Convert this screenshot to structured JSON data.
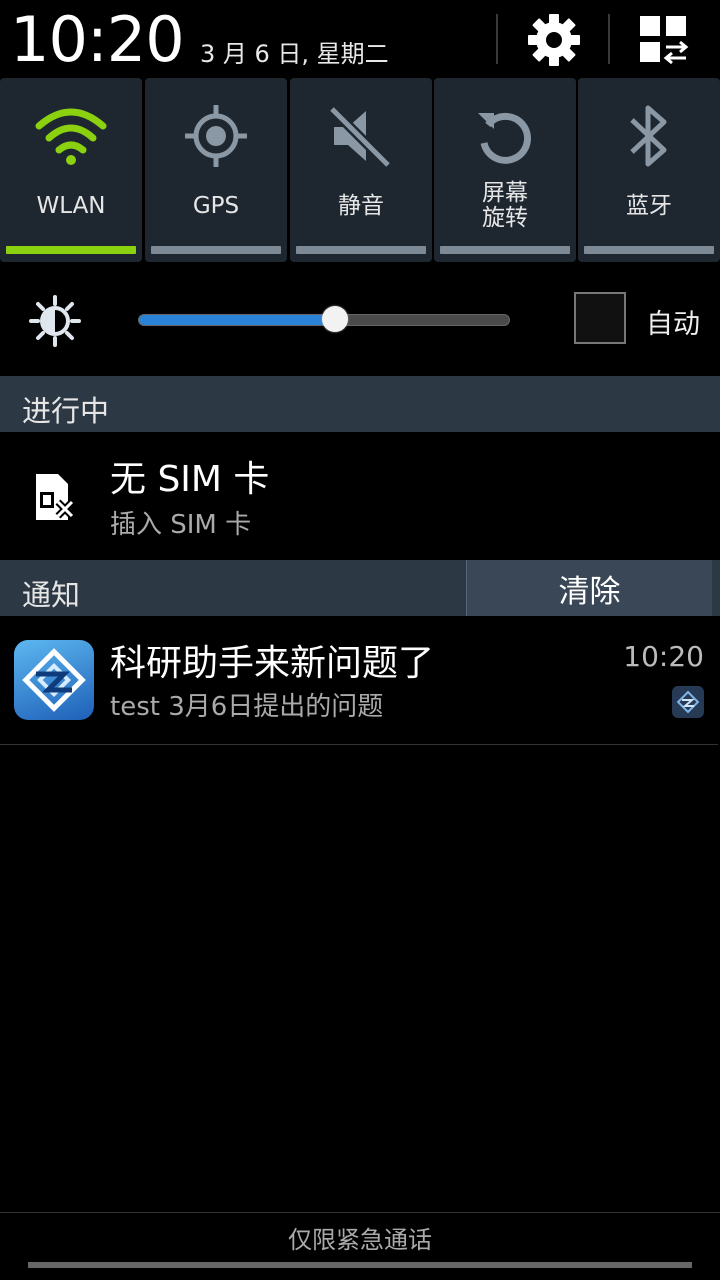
{
  "header": {
    "time": "10:20",
    "date": "3 月 6 日, 星期二",
    "settings_icon": "gear-icon",
    "toggle_view_icon": "grid-switch-icon"
  },
  "toggles": [
    {
      "label": "WLAN",
      "icon": "wifi-icon",
      "on": true
    },
    {
      "label": "GPS",
      "icon": "gps-icon",
      "on": false
    },
    {
      "label": "静音",
      "icon": "mute-icon",
      "on": false
    },
    {
      "label": "屏幕\n旋转",
      "icon": "rotate-icon",
      "on": false
    },
    {
      "label": "蓝牙",
      "icon": "bluetooth-icon",
      "on": false
    }
  ],
  "brightness": {
    "icon": "brightness-icon",
    "level": 0.53,
    "auto_label": "自动",
    "auto_checked": false
  },
  "ongoing": {
    "section_title": "进行中",
    "title": "无 SIM 卡",
    "subtitle": "插入 SIM 卡",
    "icon": "no-sim-icon"
  },
  "notifications": {
    "section_title": "通知",
    "clear_label": "清除",
    "items": [
      {
        "title": "科研助手来新问题了",
        "subtitle": "test 3月6日提出的问题",
        "time": "10:20",
        "icon": "app-icon"
      }
    ]
  },
  "footer": {
    "emergency": "仅限紧急通话"
  },
  "colors": {
    "accent_on": "#8cd10f",
    "slider": "#2a83d6",
    "section_bg": "#2d3845"
  }
}
